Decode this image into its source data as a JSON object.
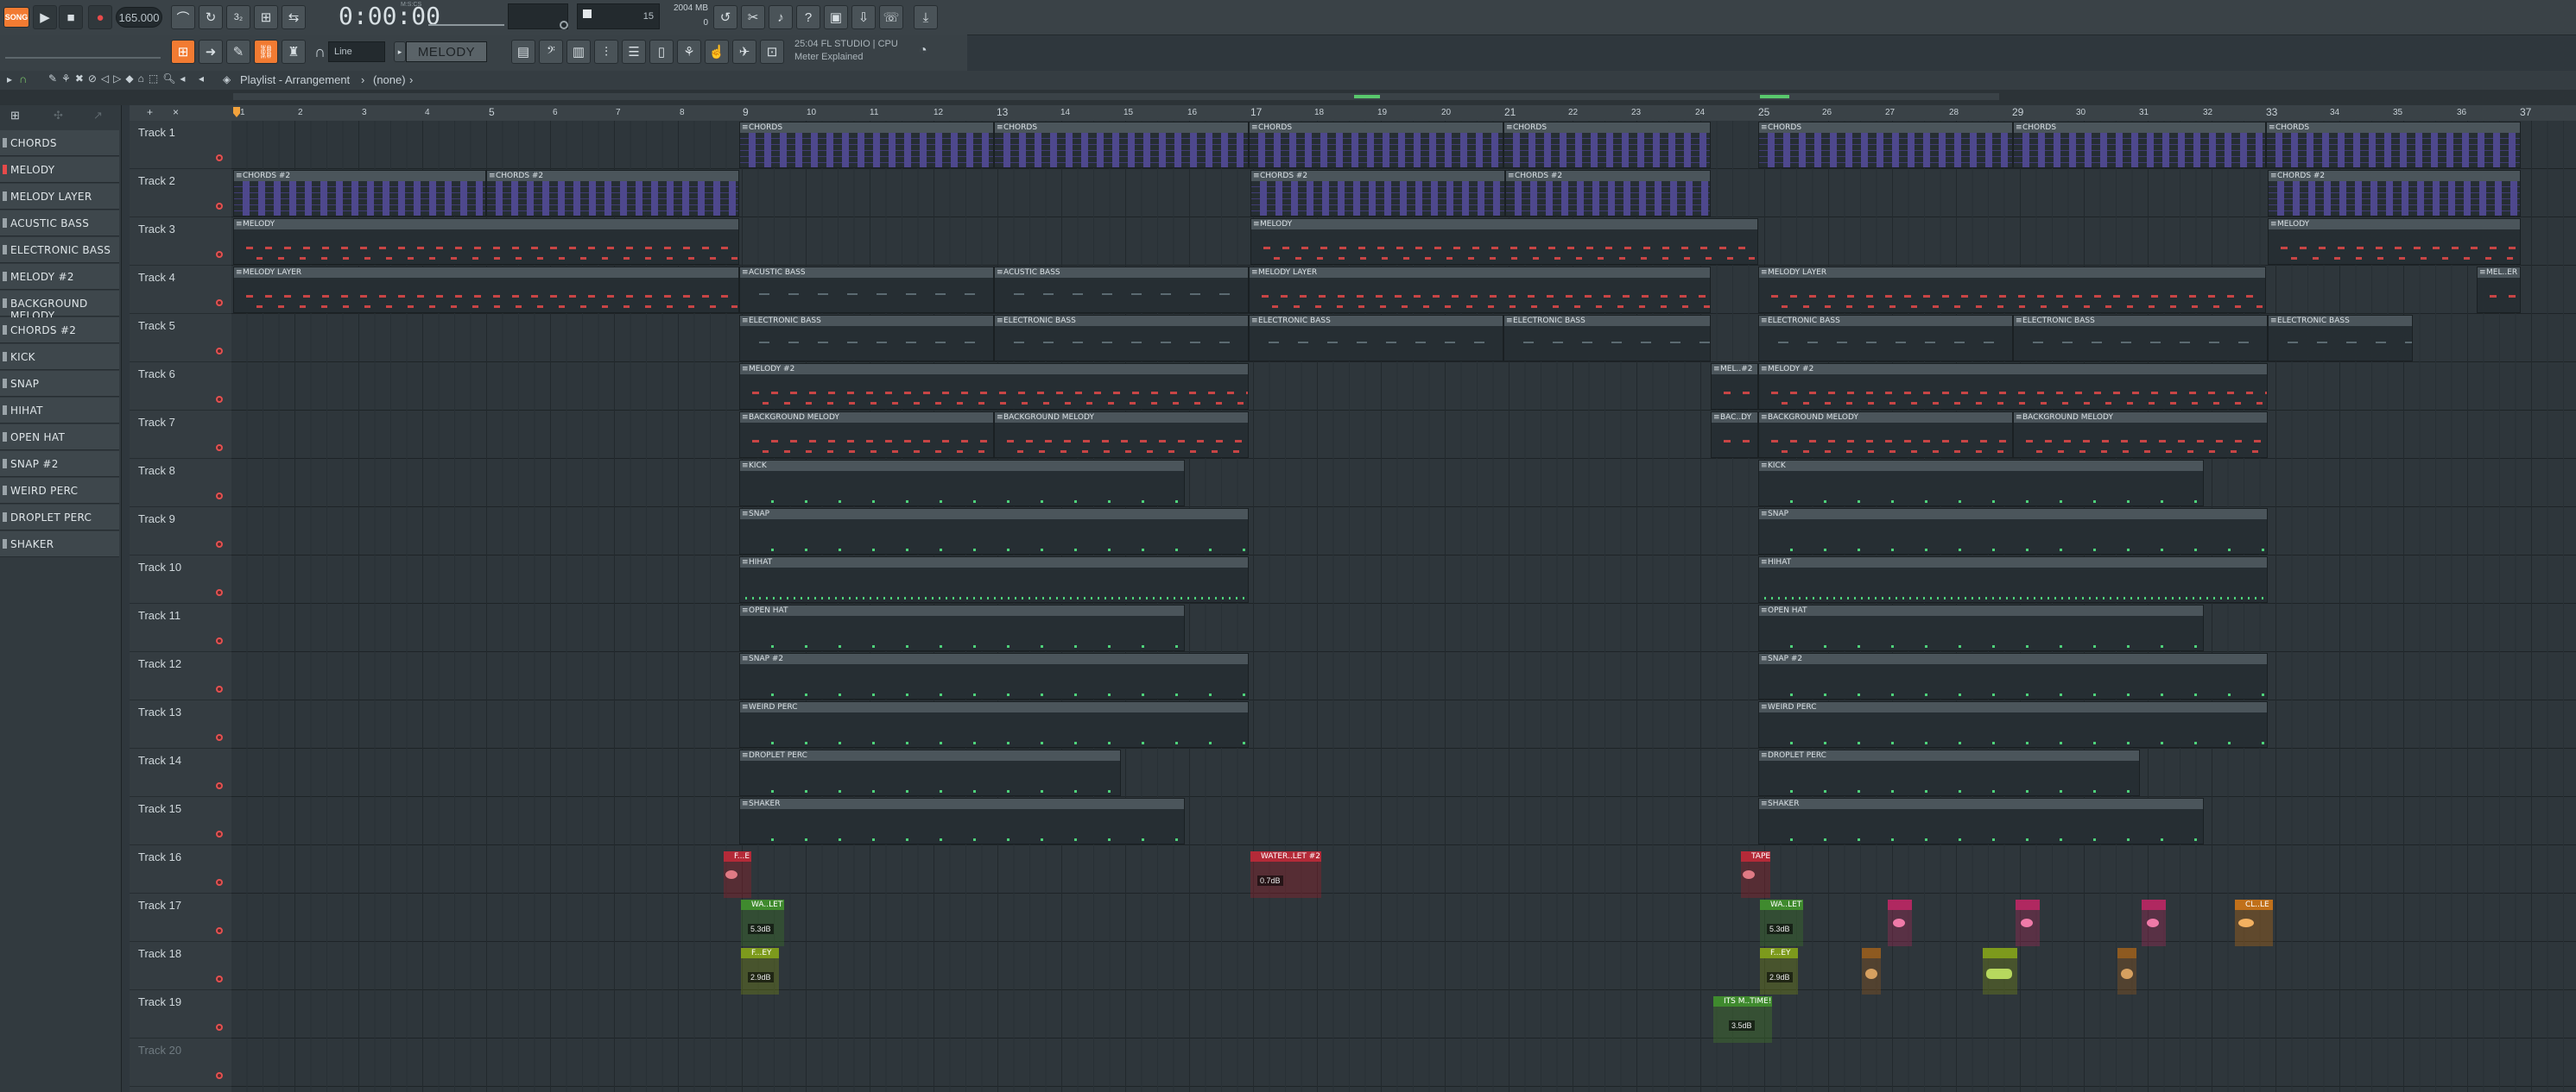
{
  "toolbar": {
    "song_mode": "SONG",
    "tempo": "165.000",
    "time": "0:00:00",
    "time_unit": "M:S:CS",
    "pattern_num": "15",
    "memory": "2004 MB",
    "memory_sub": "0",
    "snap": "Line",
    "pattern": "MELODY",
    "hint_line1": "25:04  FL STUDIO | CPU",
    "hint_line2": "Meter Explained"
  },
  "playlist": {
    "title": "Playlist - Arrangement",
    "breadcrumb": "(none)"
  },
  "colors": {
    "accent": "#f27b32",
    "chords_notes": "#6f5fd8",
    "melody_notes": "#c84545",
    "drum_hits": "#4ed27a"
  },
  "icons": [
    "play-icon",
    "stop-icon",
    "record-icon",
    "pencil-icon",
    "paint-icon",
    "delete-icon",
    "mute-icon",
    "slip-icon",
    "select-icon",
    "zoom-icon",
    "speaker-icon",
    "magnet-icon",
    "piano-icon",
    "mixer-icon",
    "browser-icon",
    "plugin-icon"
  ],
  "patterns": [
    "CHORDS",
    "MELODY",
    "MELODY LAYER",
    "ACUSTIC BASS",
    "ELECTRONIC BASS",
    "MELODY #2",
    "BACKGROUND MELODY",
    "CHORDS #2",
    "KICK",
    "SNAP",
    "HIHAT",
    "OPEN HAT",
    "SNAP #2",
    "WEIRD PERC",
    "DROPLET PERC",
    "SHAKER"
  ],
  "tracks": [
    "Track 1",
    "Track 2",
    "Track 3",
    "Track 4",
    "Track 5",
    "Track 6",
    "Track 7",
    "Track 8",
    "Track 9",
    "Track 10",
    "Track 11",
    "Track 12",
    "Track 13",
    "Track 14",
    "Track 15",
    "Track 16",
    "Track 17",
    "Track 18",
    "Track 19",
    "Track 20"
  ],
  "ruler": [
    "1",
    "2",
    "3",
    "4",
    "5",
    "6",
    "7",
    "8",
    "9",
    "10",
    "11",
    "12",
    "13",
    "14",
    "15",
    "16",
    "17",
    "18",
    "19",
    "20",
    "21",
    "22",
    "23",
    "24",
    "25",
    "26",
    "27",
    "28",
    "29",
    "30",
    "31",
    "32",
    "33",
    "34",
    "35",
    "36",
    "37"
  ],
  "clips": {
    "t1": [
      "CHORDS",
      "CHORDS",
      "CHORDS",
      "CHORDS",
      "CHORDS",
      "CHORDS",
      "CHORDS"
    ],
    "t2": [
      "CHORDS #2",
      "CHORDS #2",
      "CHORDS #2",
      "CHORDS #2",
      "CHORDS #2"
    ],
    "t3": [
      "MELODY",
      "MELODY",
      "MELODY"
    ],
    "t4": [
      "MELODY LAYER",
      "ACUSTIC BASS",
      "ACUSTIC BASS",
      "MELODY LAYER",
      "MELODY LAYER",
      "MEL..ER"
    ],
    "t5": [
      "ELECTRONIC BASS",
      "ELECTRONIC BASS",
      "ELECTRONIC BASS",
      "ELECTRONIC BASS",
      "ELECTRONIC BASS",
      "ELECTRONIC BASS",
      "ELECTRONIC BASS"
    ],
    "t6": [
      "MELODY #2",
      "MEL..#2",
      "MELODY #2"
    ],
    "t7": [
      "BACKGROUND MELODY",
      "BACKGROUND MELODY",
      "BAC..DY",
      "BACKGROUND MELODY",
      "BACKGROUND MELODY"
    ],
    "t8": [
      "KICK",
      "KICK"
    ],
    "t9": [
      "SNAP",
      "SNAP"
    ],
    "t10": [
      "HIHAT",
      "HIHAT"
    ],
    "t11": [
      "OPEN HAT",
      "OPEN HAT"
    ],
    "t12": [
      "SNAP #2",
      "SNAP #2"
    ],
    "t13": [
      "WEIRD PERC",
      "WEIRD PERC"
    ],
    "t14": [
      "DROPLET PERC",
      "DROPLET PERC"
    ],
    "t15": [
      "SHAKER",
      "SHAKER"
    ],
    "t16": [
      "F...E",
      "WATER..LET #2",
      "TAPE"
    ],
    "t16_gain": "0.7dB",
    "t17": [
      "WA..LET",
      "WA..LET",
      "CL..LE"
    ],
    "t17_gain": "5.3dB",
    "t18": [
      "F...EY",
      "F...EY"
    ],
    "t18_gain": "2.9dB",
    "t19": [
      "ITS M..TIME!"
    ],
    "t19_gain": "3.5dB"
  }
}
